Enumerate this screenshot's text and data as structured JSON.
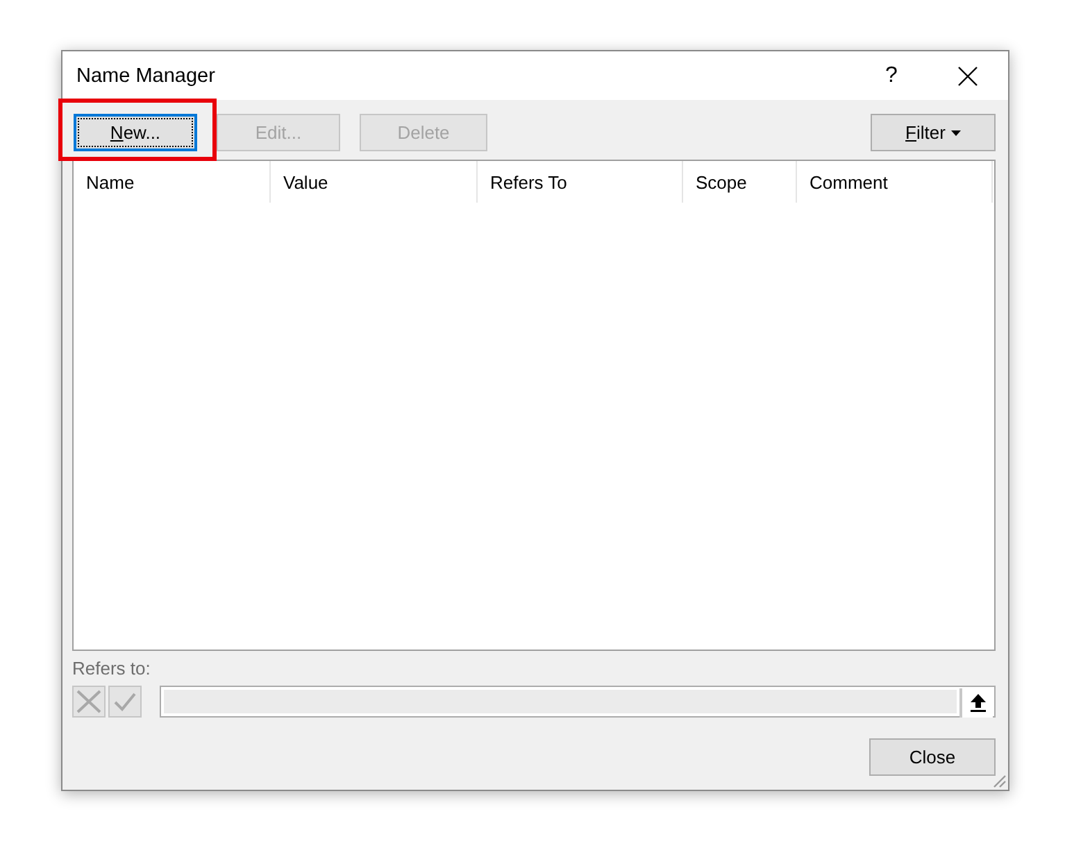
{
  "window": {
    "title": "Name Manager",
    "help_label": "?"
  },
  "toolbar": {
    "buttons": [
      {
        "label": "New...",
        "underline_first_letter": true,
        "disabled": false,
        "focused": true,
        "highlighted": true
      },
      {
        "label": "Edit...",
        "underline_first_letter": false,
        "disabled": true,
        "focused": false,
        "highlighted": false
      },
      {
        "label": "Delete",
        "underline_first_letter": false,
        "disabled": true,
        "focused": false,
        "highlighted": false
      }
    ],
    "filter": {
      "label": "Filter",
      "underline_first_letter": true
    }
  },
  "table": {
    "columns": [
      "Name",
      "Value",
      "Refers To",
      "Scope",
      "Comment"
    ]
  },
  "refers_to": {
    "label": "Refers to:",
    "disabled": true
  },
  "footer": {
    "close_label": "Close"
  }
}
